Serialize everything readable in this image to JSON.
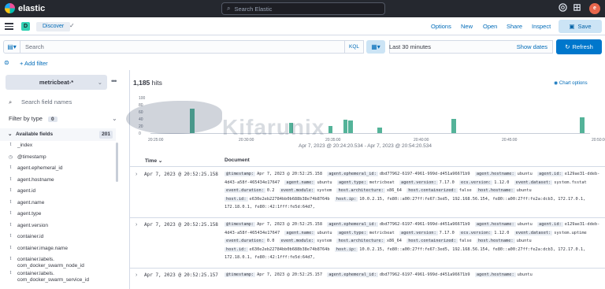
{
  "header": {
    "app_name": "elastic",
    "search_placeholder": "Search Elastic",
    "avatar_initial": "e"
  },
  "subheader": {
    "space_initial": "D",
    "breadcrumb": "Discover",
    "links": [
      "Options",
      "New",
      "Open",
      "Share",
      "Inspect"
    ],
    "save_label": "Save"
  },
  "querybar": {
    "placeholder": "Search",
    "language": "KQL",
    "date_range": "Last 30 minutes",
    "show_dates": "Show dates",
    "refresh": "Refresh"
  },
  "filters": {
    "add_filter": "+ Add filter"
  },
  "sidebar": {
    "index_pattern": "metricbeat-*",
    "search_placeholder": "Search field names",
    "filter_by_type": "Filter by type",
    "filter_count": "0",
    "available_fields_label": "Available fields",
    "available_fields_count": "201",
    "fields": [
      {
        "type": "t",
        "name": "_index"
      },
      {
        "type": "◷",
        "name": "@timestamp"
      },
      {
        "type": "t",
        "name": "agent.ephemeral_id"
      },
      {
        "type": "t",
        "name": "agent.hostname"
      },
      {
        "type": "t",
        "name": "agent.id"
      },
      {
        "type": "t",
        "name": "agent.name"
      },
      {
        "type": "t",
        "name": "agent.type"
      },
      {
        "type": "t",
        "name": "agent.version"
      },
      {
        "type": "t",
        "name": "container.id"
      },
      {
        "type": "t",
        "name": "container.image.name"
      },
      {
        "type": "t",
        "name": "container.labels.\ncom_docker_swarm_node_id"
      },
      {
        "type": "t",
        "name": "container.labels.\ncom_docker_swarm_service_id"
      }
    ]
  },
  "main": {
    "hits_count": "1,185",
    "hits_label": "hits",
    "chart_options": "Chart options",
    "time_range": "Apr 7, 2023 @ 20:24:20.534 - Apr 7, 2023 @ 20:54:20.534",
    "column_time": "Time",
    "column_document": "Document",
    "watermark": "Kifarunix"
  },
  "chart_data": {
    "type": "bar",
    "y_ticks": [
      "100",
      "80",
      "60",
      "40",
      "20",
      "0"
    ],
    "x_ticks": [
      "20:25:00",
      "20:30:00",
      "20:35:00",
      "20:40:00",
      "20:45:00",
      "20:50:00"
    ],
    "ylim": [
      0,
      100
    ],
    "series_color": "#54b399",
    "values": [
      0,
      0,
      0,
      0,
      0,
      0,
      0,
      0,
      70,
      0,
      0,
      0,
      0,
      0,
      0,
      0,
      0,
      0,
      0,
      0,
      0,
      0,
      0,
      0,
      0,
      0,
      0,
      0,
      30,
      0,
      0,
      0,
      0,
      0,
      0,
      0,
      20,
      0,
      0,
      38,
      35,
      0,
      0,
      0,
      0,
      0,
      15,
      0,
      0,
      0,
      0,
      0,
      0,
      0,
      0,
      0,
      0,
      0,
      0,
      0,
      0,
      40,
      0,
      0,
      0,
      0,
      0,
      0,
      0,
      0,
      0,
      0,
      0,
      0,
      0,
      0,
      0,
      0,
      0,
      0,
      0,
      0,
      0,
      0,
      0,
      0,
      0,
      45,
      0
    ]
  },
  "documents": [
    {
      "time": "Apr 7, 2023 @ 20:52:25.158",
      "fields": [
        [
          "@timestamp:",
          "Apr 7, 2023 @ 20:52:25.158"
        ],
        [
          "agent.ephemeral_id:",
          "dbd77962-6197-4961-999d-d451a96671b9"
        ],
        [
          "agent.hostname:",
          "ubuntu"
        ],
        [
          "agent.id:",
          "e129ae31-ddeb-4d43-a58f-465434e17647"
        ],
        [
          "agent.name:",
          "ubuntu"
        ],
        [
          "agent.type:",
          "metricbeat"
        ],
        [
          "agent.version:",
          "7.17.0"
        ],
        [
          "ecs.version:",
          "1.12.0"
        ],
        [
          "event.dataset:",
          "system.fsstat"
        ],
        [
          "event.duration:",
          "0.2"
        ],
        [
          "event.module:",
          "system"
        ],
        [
          "host.architecture:",
          "x86_64"
        ],
        [
          "host.containerized:",
          "false"
        ],
        [
          "host.hostname:",
          "ubuntu"
        ],
        [
          "host.id:",
          "e630e2eb22784bb0b688b38e74b8764b"
        ],
        [
          "host.ip:",
          "10.0.2.15, fe80::a00:27ff:fe67:3ed5, 192.168.56.154, fe80::a00:27ff:fe2a:dcb3, 172.17.0.1, 172.18.0.1, fe80::42:1fff:fe5d:64d7,"
        ]
      ]
    },
    {
      "time": "Apr 7, 2023 @ 20:52:25.158",
      "fields": [
        [
          "@timestamp:",
          "Apr 7, 2023 @ 20:52:25.158"
        ],
        [
          "agent.ephemeral_id:",
          "dbd77962-6197-4961-999d-d451a96671b9"
        ],
        [
          "agent.hostname:",
          "ubuntu"
        ],
        [
          "agent.id:",
          "e129ae31-ddeb-4d43-a58f-465434e17647"
        ],
        [
          "agent.name:",
          "ubuntu"
        ],
        [
          "agent.type:",
          "metricbeat"
        ],
        [
          "agent.version:",
          "7.17.0"
        ],
        [
          "ecs.version:",
          "1.12.0"
        ],
        [
          "event.dataset:",
          "system.uptime"
        ],
        [
          "event.duration:",
          "0.0"
        ],
        [
          "event.module:",
          "system"
        ],
        [
          "host.architecture:",
          "x86_64"
        ],
        [
          "host.containerized:",
          "false"
        ],
        [
          "host.hostname:",
          "ubuntu"
        ],
        [
          "host.id:",
          "e630e2eb22784bb0b688b38e74b8764b"
        ],
        [
          "host.ip:",
          "10.0.2.15, fe80::a00:27ff:fe67:3ed5, 192.168.56.154, fe80::a00:27ff:fe2a:dcb3, 172.17.0.1, 172.18.0.1, fe80::42:1fff:fe5d:64d7,"
        ]
      ]
    },
    {
      "time": "Apr 7, 2023 @ 20:52:25.157",
      "fields": [
        [
          "@timestamp:",
          "Apr 7, 2023 @ 20:52:25.157"
        ],
        [
          "agent.ephemeral_id:",
          "dbd77962-6197-4961-999d-d451a96671b9"
        ],
        [
          "agent.hostname:",
          "ubuntu"
        ]
      ]
    }
  ]
}
